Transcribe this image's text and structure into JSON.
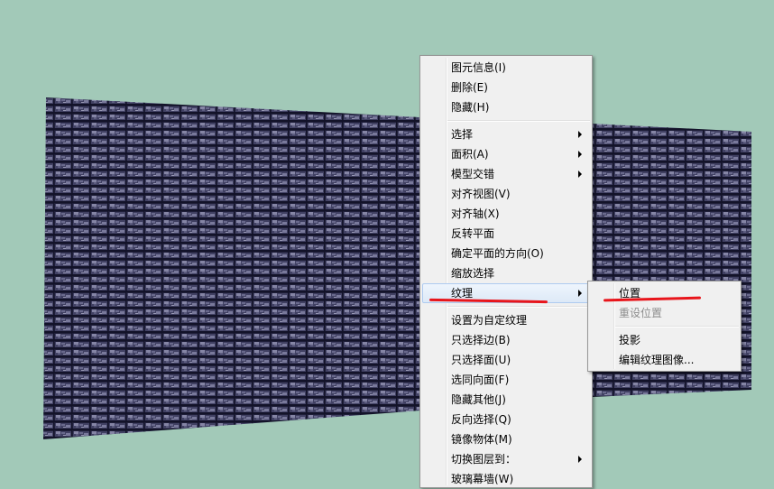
{
  "context_menu": {
    "groups": [
      [
        {
          "label": "图元信息(I)"
        },
        {
          "label": "删除(E)"
        },
        {
          "label": "隐藏(H)"
        }
      ],
      [
        {
          "label": "选择",
          "submenu": true
        },
        {
          "label": "面积(A)",
          "submenu": true
        },
        {
          "label": "模型交错",
          "submenu": true
        },
        {
          "label": "对齐视图(V)"
        },
        {
          "label": "对齐轴(X)"
        },
        {
          "label": "反转平面"
        },
        {
          "label": "确定平面的方向(O)"
        },
        {
          "label": "缩放选择"
        },
        {
          "label": "纹理",
          "submenu": true,
          "highlighted": true
        }
      ],
      [
        {
          "label": "设置为自定纹理"
        },
        {
          "label": "只选择边(B)"
        },
        {
          "label": "只选择面(U)"
        },
        {
          "label": "选同向面(F)"
        },
        {
          "label": "隐藏其他(J)"
        },
        {
          "label": "反向选择(Q)"
        },
        {
          "label": "镜像物体(M)"
        },
        {
          "label": "切换图层到：",
          "submenu": true
        },
        {
          "label": "玻璃幕墙(W)"
        }
      ]
    ]
  },
  "texture_submenu": {
    "groups": [
      [
        {
          "label": "位置"
        },
        {
          "label": "重设位置",
          "disabled": true
        }
      ],
      [
        {
          "label": "投影"
        },
        {
          "label": "编辑纹理图像..."
        }
      ]
    ]
  },
  "colors": {
    "background": "#a2c9b8",
    "texture_dark": "#1b1b33",
    "texture_light": "#a8a8c8",
    "annotation_red": "#e8151b"
  }
}
